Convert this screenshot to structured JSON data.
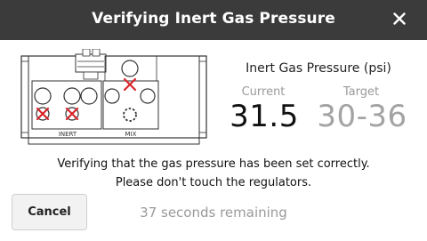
{
  "dialog": {
    "title": "Verifying Inert Gas Pressure",
    "close_icon": "close-x-icon"
  },
  "diagram": {
    "labels": {
      "inert": "INERT",
      "mix": "MIX"
    },
    "marked_regulators": [
      "mix-top",
      "inert-lower-left",
      "inert-lower-middle"
    ]
  },
  "readout": {
    "title": "Inert Gas Pressure (psi)",
    "current_label": "Current",
    "target_label": "Target",
    "current_value": "31.5",
    "target_value": "30-36"
  },
  "message": {
    "line1": "Verifying that the gas pressure has been set correctly.",
    "line2": "Please don't touch the regulators."
  },
  "footer": {
    "cancel_label": "Cancel",
    "remaining_text": "37 seconds remaining"
  },
  "colors": {
    "titlebar": "#3b3b3b",
    "cross": "#d9262b",
    "muted": "#9a9a9a"
  }
}
